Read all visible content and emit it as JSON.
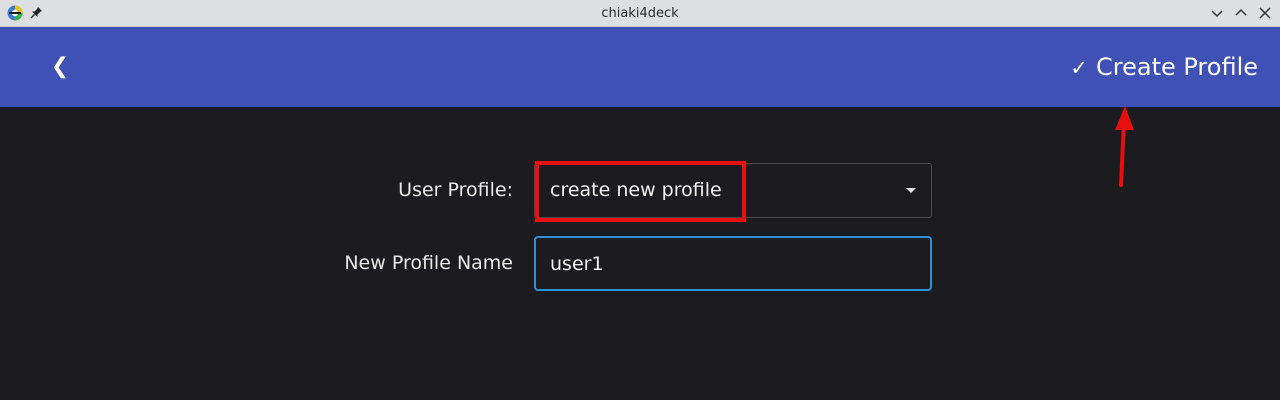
{
  "window": {
    "title": "chiaki4deck",
    "icons": [
      "app-icon",
      "pin-icon",
      "minimize-icon",
      "maximize-icon",
      "close-icon"
    ]
  },
  "appbar": {
    "back_label": "❮",
    "check_glyph": "✓",
    "create_label": "Create Profile",
    "color": "#3f51b5"
  },
  "form": {
    "user_profile_label": "User Profile:",
    "user_profile_value": "create new profile",
    "new_profile_name_label": "New Profile Name",
    "new_profile_name_value": "user1"
  },
  "annotations": {
    "highlight_color": "#e80f0f"
  },
  "colors": {
    "background": "#1c1b1f",
    "focus_border": "#2f8fd8"
  }
}
